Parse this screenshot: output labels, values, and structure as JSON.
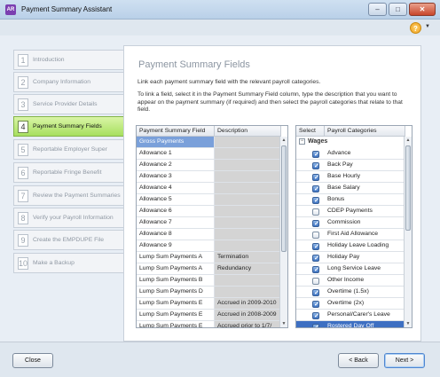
{
  "window": {
    "title": "Payment Summary Assistant",
    "app_icon_text": "AR",
    "minimize_glyph": "–",
    "maximize_glyph": "□",
    "close_glyph": "✕",
    "help_glyph": "?",
    "help_menu_glyph": "▼"
  },
  "steps": [
    {
      "num": "1",
      "label": "Introduction",
      "active": false
    },
    {
      "num": "2",
      "label": "Company Information",
      "active": false
    },
    {
      "num": "3",
      "label": "Service Provider Details",
      "active": false
    },
    {
      "num": "4",
      "label": "Payment Summary Fields",
      "active": true
    },
    {
      "num": "5",
      "label": "Reportable Employer Super",
      "active": false
    },
    {
      "num": "6",
      "label": "Reportable Fringe Benefit",
      "active": false
    },
    {
      "num": "7",
      "label": "Review the Payment Summaries",
      "active": false
    },
    {
      "num": "8",
      "label": "Verify your Payroll Information",
      "active": false
    },
    {
      "num": "9",
      "label": "Create the EMPDUPE File",
      "active": false
    },
    {
      "num": "10",
      "label": "Make a Backup",
      "active": false
    }
  ],
  "main": {
    "heading": "Payment Summary Fields",
    "intro": "Link each payment summary field with the relevant payroll categories.",
    "instructions": "To link a field, select it in the Payment Summary Field column,  type the description that you want to appear on the payment summary (if required) and then select the payroll categories that relate to that field."
  },
  "fields_grid": {
    "columns": [
      "Payment Summary Field",
      "Description"
    ],
    "rows": [
      {
        "field": "Gross Payments",
        "description": "",
        "selected": true
      },
      {
        "field": "Allowance 1",
        "description": ""
      },
      {
        "field": "Allowance 2",
        "description": ""
      },
      {
        "field": "Allowance 3",
        "description": ""
      },
      {
        "field": "Allowance 4",
        "description": ""
      },
      {
        "field": "Allowance 5",
        "description": ""
      },
      {
        "field": "Allowance 6",
        "description": ""
      },
      {
        "field": "Allowance 7",
        "description": ""
      },
      {
        "field": "Allowance 8",
        "description": ""
      },
      {
        "field": "Allowance 9",
        "description": ""
      },
      {
        "field": "Lump Sum Payments A",
        "description": "Termination"
      },
      {
        "field": "Lump Sum Payments A",
        "description": "Redundancy"
      },
      {
        "field": "Lump Sum Payments B",
        "description": ""
      },
      {
        "field": "Lump Sum Payments D",
        "description": ""
      },
      {
        "field": "Lump Sum Payments E",
        "description": "Accrued in 2009-2010"
      },
      {
        "field": "Lump Sum Payments E",
        "description": "Accrued in 2008-2009"
      },
      {
        "field": "Lump Sum Payments E",
        "description": "Accrued prior to 1/7/"
      }
    ]
  },
  "categories_grid": {
    "columns": [
      "Select",
      "Payroll Categories"
    ],
    "group": {
      "label": "Wages",
      "toggle": "−"
    },
    "rows": [
      {
        "label": "Advance",
        "checked": true
      },
      {
        "label": "Back Pay",
        "checked": true
      },
      {
        "label": "Base Hourly",
        "checked": true
      },
      {
        "label": "Base Salary",
        "checked": true
      },
      {
        "label": "Bonus",
        "checked": true
      },
      {
        "label": "CDEP Payments",
        "checked": false
      },
      {
        "label": "Commission",
        "checked": true
      },
      {
        "label": "First Aid Allowance",
        "checked": false
      },
      {
        "label": "Holiday Leave Loading",
        "checked": true
      },
      {
        "label": "Holiday Pay",
        "checked": true
      },
      {
        "label": "Long Service Leave",
        "checked": true
      },
      {
        "label": "Other Income",
        "checked": false
      },
      {
        "label": "Overtime (1.5x)",
        "checked": true
      },
      {
        "label": "Overtime (2x)",
        "checked": true
      },
      {
        "label": "Personal/Carer's Leave",
        "checked": true
      },
      {
        "label": "Rostered Day Off",
        "checked": true,
        "selected": true
      }
    ]
  },
  "footer": {
    "close_label": "Close",
    "back_label": "< Back",
    "next_label": "Next >"
  }
}
